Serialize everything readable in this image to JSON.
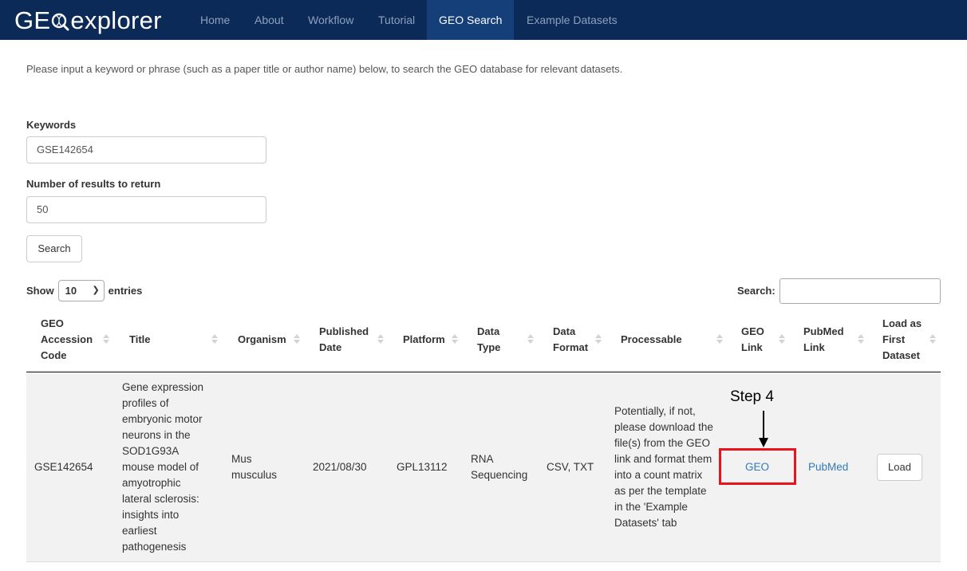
{
  "navbar": {
    "brand_left": "GE",
    "brand_right": "explorer",
    "items": [
      {
        "label": "Home"
      },
      {
        "label": "About"
      },
      {
        "label": "Workflow"
      },
      {
        "label": "Tutorial"
      },
      {
        "label": "GEO Search",
        "active": true
      },
      {
        "label": "Example Datasets"
      }
    ],
    "colors": {
      "background": "#0b2a57",
      "active": "#153f78"
    }
  },
  "intro_text": "Please input a keyword or phrase (such as a paper title or author name) below, to search the GEO database for relevant datasets.",
  "form": {
    "keywords_label": "Keywords",
    "keywords_value": "GSE142654",
    "results_label": "Number of results to return",
    "results_value": "50",
    "search_button": "Search"
  },
  "table_controls": {
    "show_label": "Show",
    "entries_value": "10",
    "entries_label": "entries",
    "search_label": "Search:",
    "search_value": ""
  },
  "table": {
    "headers": [
      [
        "GEO",
        "Accession",
        "Code"
      ],
      [
        "Title"
      ],
      [
        "Organism"
      ],
      [
        "Published",
        "Date"
      ],
      [
        "Platform"
      ],
      [
        "Data",
        "Type"
      ],
      [
        "Data",
        "Format"
      ],
      [
        "Processable"
      ],
      [
        "GEO",
        "Link"
      ],
      [
        "PubMed",
        "Link"
      ],
      [
        "Load as",
        "First",
        "Dataset"
      ]
    ],
    "rows": [
      {
        "accession": "GSE142654",
        "title": [
          "Gene expression",
          "profiles of",
          "embryonic motor",
          "neurons in the",
          "SOD1G93A",
          "mouse model of",
          "amyotrophic",
          "lateral sclerosis:",
          "insights into",
          "earliest",
          "pathogenesis"
        ],
        "organism": [
          "Mus",
          "musculus"
        ],
        "published_date": "2021/08/30",
        "platform": "GPL13112",
        "data_type": [
          "RNA",
          "Sequencing"
        ],
        "data_format": "CSV, TXT",
        "processable": [
          "Potentially, if not,",
          "please download the",
          "file(s) from the GEO",
          "link and format them",
          "into a count matrix",
          "as per the template",
          "in the 'Example",
          "Datasets' tab"
        ],
        "geo_link": "GEO",
        "pubmed_link": "PubMed",
        "load_button": "Load"
      }
    ]
  },
  "annotation": {
    "step_label": "Step 4",
    "highlight_color": "#e8141c"
  }
}
